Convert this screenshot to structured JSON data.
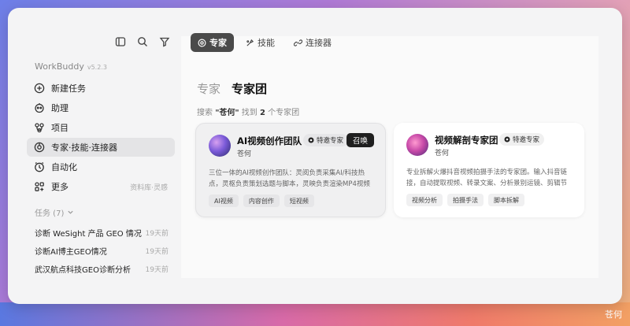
{
  "app": {
    "name": "WorkBuddy",
    "version": "v5.2.3"
  },
  "nav": [
    {
      "label": "新建任务",
      "icon": "plus-circle-icon"
    },
    {
      "label": "助理",
      "icon": "robot-icon"
    },
    {
      "label": "项目",
      "icon": "project-icon"
    },
    {
      "label": "专家·技能·连接器",
      "icon": "expert-icon",
      "active": true
    },
    {
      "label": "自动化",
      "icon": "clock-icon"
    },
    {
      "label": "更多",
      "icon": "grid-icon",
      "hint": "资料库·灵感"
    }
  ],
  "tasks_header": "任务 (7)",
  "tasks": [
    {
      "name": "诊断 WeSight 产品 GEO 情况",
      "ago": "19天前"
    },
    {
      "name": "诊断AI博主GEO情况",
      "ago": "19天前"
    },
    {
      "name": "武汉航点科技GEO诊断分析",
      "ago": "19天前"
    }
  ],
  "tabs": [
    {
      "label": "专家",
      "active": true
    },
    {
      "label": "技能"
    },
    {
      "label": "连接器"
    }
  ],
  "subtabs": [
    {
      "label": "专家"
    },
    {
      "label": "专家团",
      "active": true
    }
  ],
  "search": {
    "prefix": "搜索 ",
    "query": "\"苍何\"",
    "middle": " 找到 ",
    "count": "2",
    "suffix": " 个专家团"
  },
  "cards": [
    {
      "title": "AI视频创作团队",
      "badge": "特邀专家",
      "owner": "苍何",
      "action": "召唤",
      "desc": "三位一体的AI视频创作团队：灵阅负责采集AI/科技热点，灵枢负责策划选题与脚本，灵映负责渲染MP4视频",
      "tags": [
        "AI视频",
        "内容创作",
        "短视频"
      ]
    },
    {
      "title": "视频解剖专家团",
      "badge": "特邀专家",
      "owner": "苍何",
      "desc": "专业拆解火爆抖音视频拍摄手法的专家团。输入抖音链接，自动提取视频、转录文案、分析景别运镜、剪辑节奏",
      "tags": [
        "视频分析",
        "拍摄手法",
        "脚本拆解"
      ]
    }
  ],
  "watermark": "苍何"
}
